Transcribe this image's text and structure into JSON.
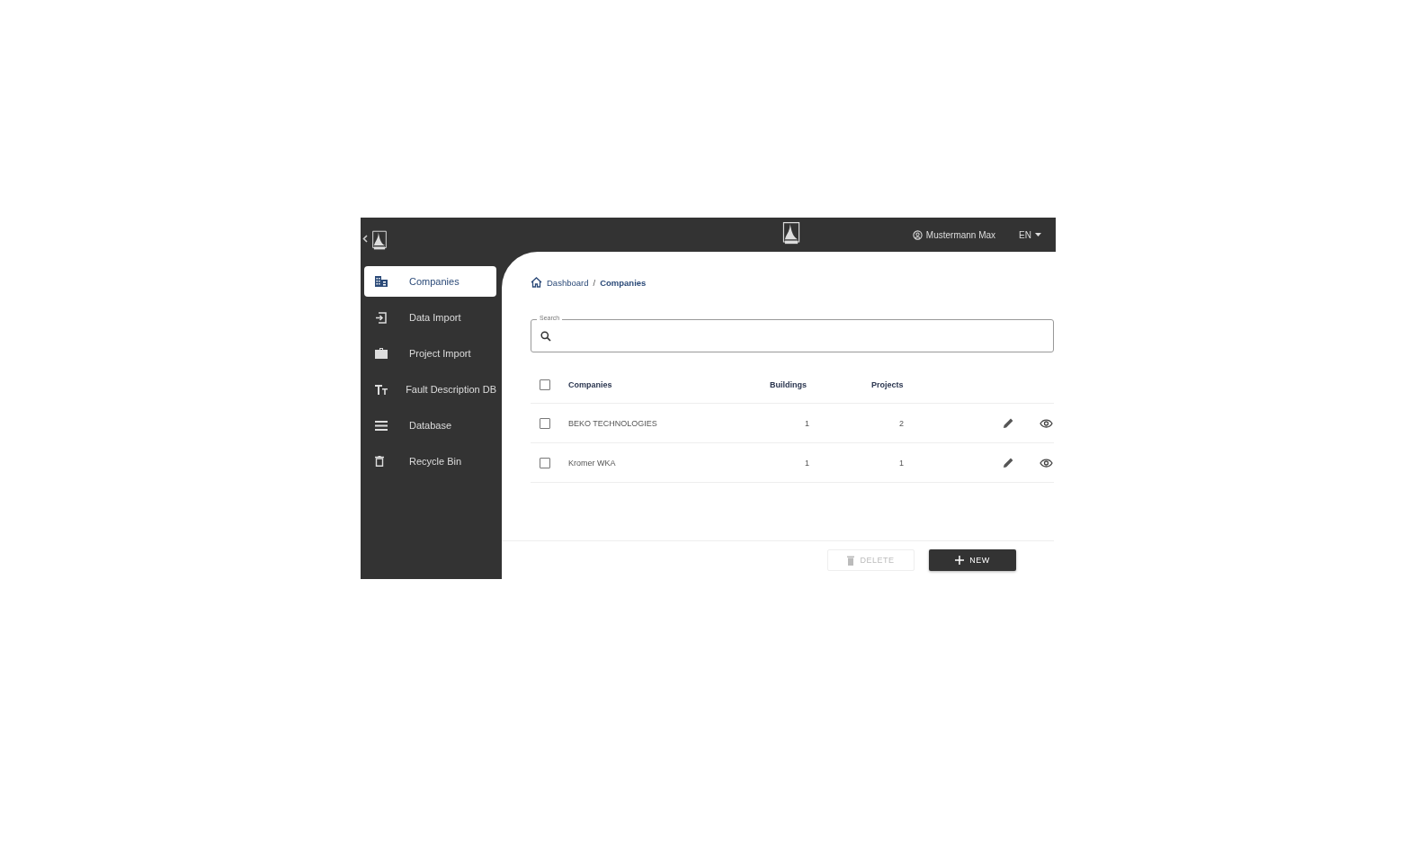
{
  "header": {
    "user": "Mustermann Max",
    "language": "EN"
  },
  "sidebar": {
    "items": [
      {
        "label": "Companies",
        "kind": "building",
        "selected": true
      },
      {
        "label": "Data Import",
        "kind": "import",
        "selected": false
      },
      {
        "label": "Project Import",
        "kind": "briefcase",
        "selected": false
      },
      {
        "label": "Fault Description DB",
        "kind": "text",
        "selected": false
      },
      {
        "label": "Database",
        "kind": "list",
        "selected": false
      },
      {
        "label": "Recycle Bin",
        "kind": "trash",
        "selected": false
      }
    ]
  },
  "breadcrumb": [
    "Dashboard",
    "Companies"
  ],
  "breadcrumb_separator": "/",
  "search": {
    "label": "Search"
  },
  "table": {
    "header_checked": false,
    "columns": [
      "Companies",
      "Buildings",
      "Projects"
    ],
    "rows": [
      {
        "checked": false,
        "cells": [
          "BEKO TECHNOLOGIES",
          "1",
          "2"
        ]
      },
      {
        "checked": false,
        "cells": [
          "Kromer WKA",
          "1",
          "1"
        ]
      }
    ]
  },
  "actions": {
    "delete": {
      "label": "DELETE",
      "disabled": true
    },
    "new": {
      "label": "NEW"
    }
  }
}
